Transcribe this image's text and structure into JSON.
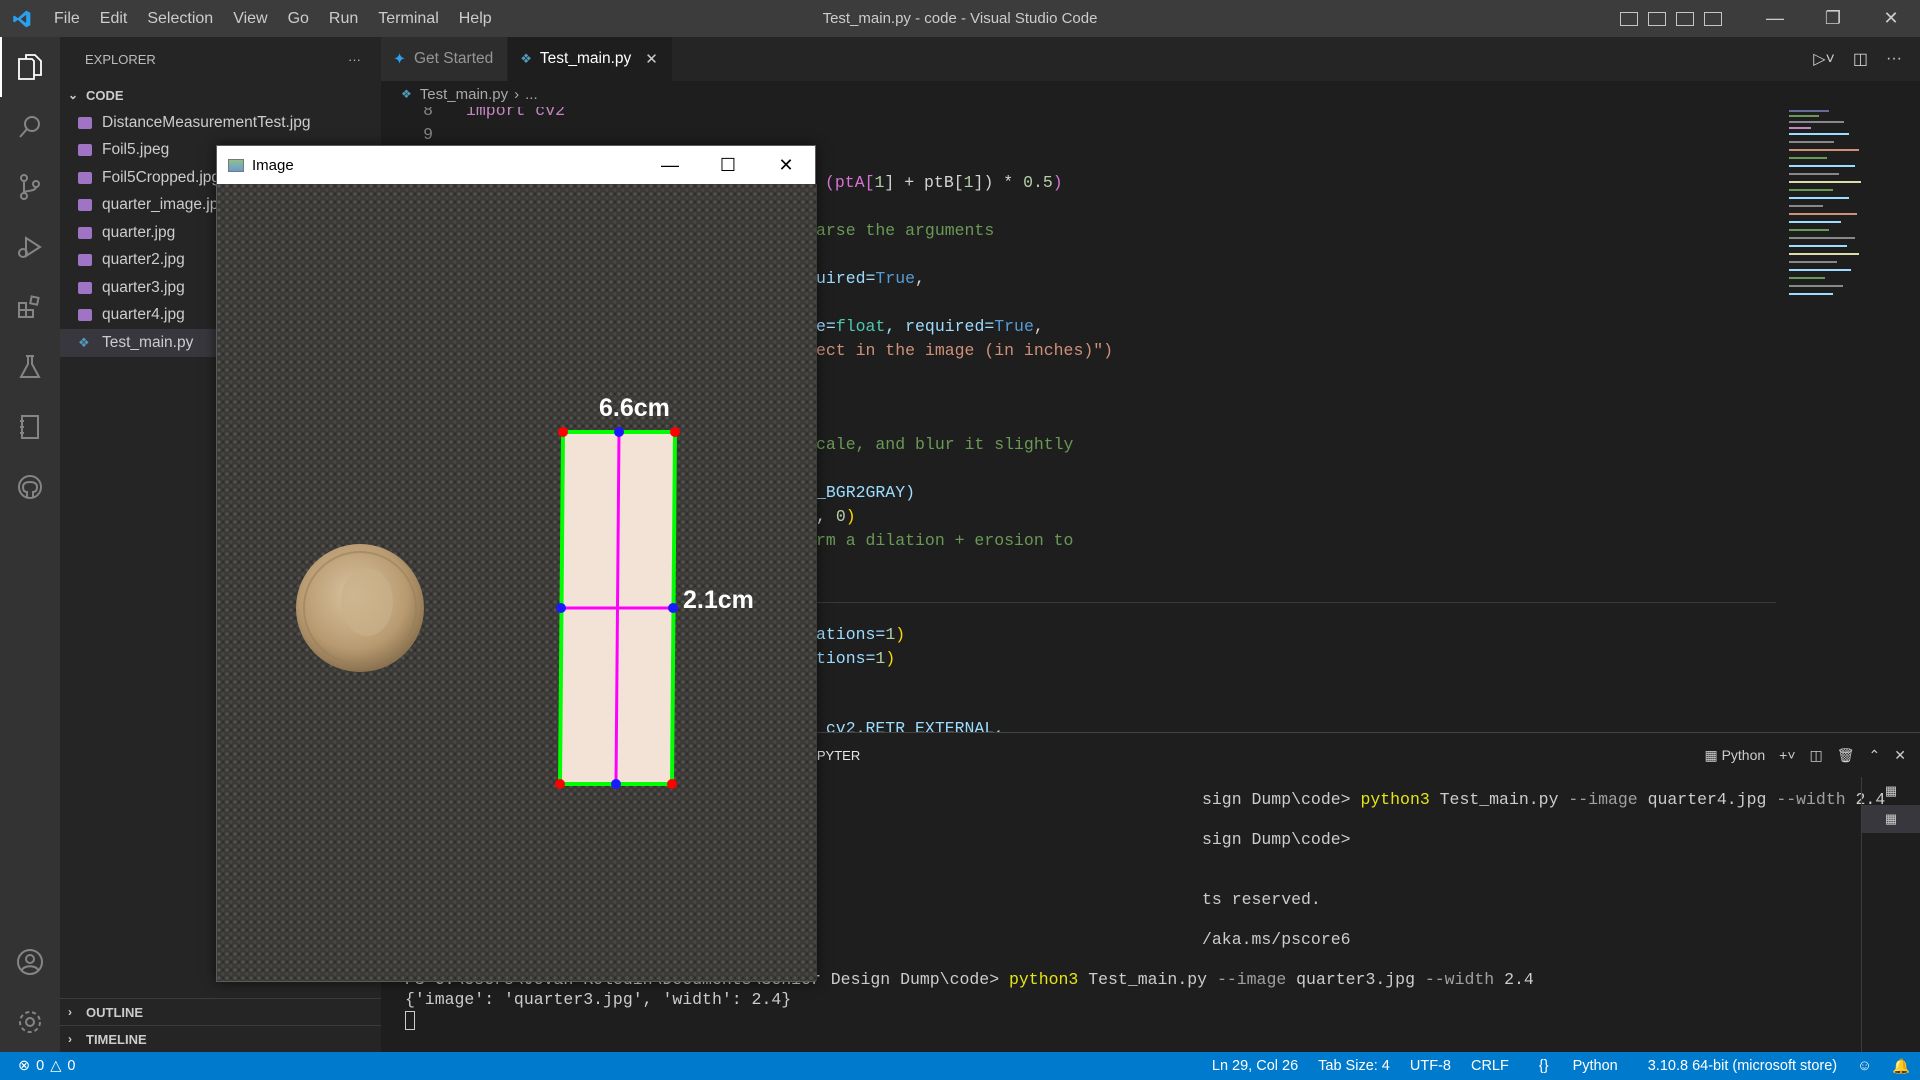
{
  "window": {
    "title": "Test_main.py - code - Visual Studio Code"
  },
  "menu": [
    "File",
    "Edit",
    "Selection",
    "View",
    "Go",
    "Run",
    "Terminal",
    "Help"
  ],
  "explorer": {
    "header": "EXPLORER",
    "more": "···",
    "folder": "CODE",
    "files": [
      {
        "name": "DistanceMeasurementTest.jpg",
        "kind": "image"
      },
      {
        "name": "Foil5.jpeg",
        "kind": "image"
      },
      {
        "name": "Foil5Cropped.jpg",
        "kind": "image"
      },
      {
        "name": "quarter_image.jpg",
        "kind": "image"
      },
      {
        "name": "quarter.jpg",
        "kind": "image"
      },
      {
        "name": "quarter2.jpg",
        "kind": "image"
      },
      {
        "name": "quarter3.jpg",
        "kind": "image"
      },
      {
        "name": "quarter4.jpg",
        "kind": "image"
      },
      {
        "name": "Test_main.py",
        "kind": "python"
      }
    ],
    "outline": "OUTLINE",
    "timeline": "TIMELINE"
  },
  "tabs": [
    {
      "label": "Get Started",
      "active": false
    },
    {
      "label": "Test_main.py",
      "active": true,
      "close": "✕"
    }
  ],
  "breadcrumb": {
    "file": "Test_main.py",
    "rest": "..."
  },
  "editor": {
    "lines": [
      {
        "n": "8",
        "text": "import cv2"
      },
      {
        "n": "9",
        "text": ""
      }
    ],
    "fragments": {
      "f1a": "(ptA[",
      "f1b": "1",
      "f1c": "] + ptB[",
      "f1d": "1",
      "f1e": "]) * ",
      "f1f": "0.5",
      "f1g": ")",
      "f2": "arse the arguments",
      "f3a": "uired=",
      "f3b": "True",
      "f3c": ",",
      "f4a": "e=",
      "f4b": "float",
      "f4c": ", required=",
      "f4d": "True",
      "f4e": ",",
      "f5": "ect in the image (in inches)\")",
      "f6": "cale, and blur it slightly",
      "f7": "_BGR2GRAY)",
      "f8a": ", ",
      "f8b": "0",
      "f8c": ")",
      "f9": "rm a dilation + erosion to",
      "f10a": "ations=",
      "f10b": "1",
      "f10c": ")",
      "f11a": "tions=",
      "f11b": "1",
      "f11c": ")",
      "f12": " cv2.RETR_EXTERNAL,"
    }
  },
  "panel": {
    "tab": "JUPYTER",
    "profile": "Python",
    "terminal": {
      "l1a": "sign Dump\\code> ",
      "l1cmd": "python3",
      "l1b": " Test_main.py ",
      "l1c": "--image",
      "l1d": " quarter4.jpg ",
      "l1e": "--width",
      "l1f": " 2.4",
      "l2": "sign Dump\\code>",
      "l3": "ts reserved.",
      "l4": "/aka.ms/pscore6",
      "l5a": "PS C:\\Users\\Jovan Koledin\\Documents\\Senior Design Dump\\code> ",
      "l5cmd": "python3",
      "l5b": " Test_main.py ",
      "l5c": "--image",
      "l5d": " quarter3.jpg ",
      "l5e": "--width",
      "l5f": " 2.4",
      "l6": "{'image': 'quarter3.jpg', 'width': 2.4}"
    }
  },
  "statusbar": {
    "errors": "0",
    "warnings": "0",
    "position": "Ln 29, Col 26",
    "tabsize": "Tab Size: 4",
    "encoding": "UTF-8",
    "eol": "CRLF",
    "language": "Python",
    "interpreter": "3.10.8 64-bit (microsoft store)"
  },
  "image_window": {
    "title": "Image",
    "label_width": "6.6cm",
    "label_height": "2.1cm"
  },
  "colors": {
    "accent": "#007acc",
    "box": "#00ff00",
    "midline": "#ff00ff",
    "corner": "#ff0000",
    "midpoint": "#0000ff"
  }
}
